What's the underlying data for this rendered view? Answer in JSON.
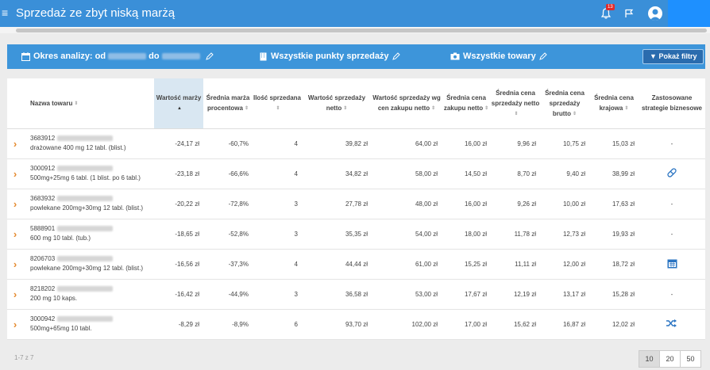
{
  "header": {
    "title": "Sprzedaż ze zbyt niską marżą",
    "notification_count": "13"
  },
  "filters": {
    "period_label": "Okres analizy: od",
    "period_to": "do",
    "points_label": "Wszystkie punkty sprzedaży",
    "products_label": "Wszystkie towary",
    "show_filters_label": "Pokaż filtry"
  },
  "table": {
    "columns": [
      "Nazwa towaru",
      "Wartość marży",
      "Średnia marża procentowa",
      "Ilość sprzedana",
      "Wartość sprzedaży netto",
      "Wartość sprzedaży wg cen zakupu netto",
      "Średnia cena zakupu netto",
      "Średnia cena sprzedaży netto",
      "Średnia cena sprzedaży brutto",
      "Średnia cena krajowa",
      "Zastosowane strategie biznesowe"
    ],
    "rows": [
      {
        "code": "3683912",
        "desc": "drażowane 400 mg 12 tabl. (blist.)",
        "margin_value": "-24,17 zł",
        "margin_pct": "-60,7%",
        "qty": "4",
        "sales_net": "39,82 zł",
        "sales_purchase": "64,00 zł",
        "avg_purchase": "16,00 zł",
        "avg_sale_net": "9,96 zł",
        "avg_sale_gross": "10,75 zł",
        "avg_national": "15,03 zł",
        "strategy": "-",
        "strategy_icon": ""
      },
      {
        "code": "3000912",
        "desc": "500mg+25mg 6 tabl. (1 blist. po 6 tabl.)",
        "margin_value": "-23,18 zł",
        "margin_pct": "-66,6%",
        "qty": "4",
        "sales_net": "34,82 zł",
        "sales_purchase": "58,00 zł",
        "avg_purchase": "14,50 zł",
        "avg_sale_net": "8,70 zł",
        "avg_sale_gross": "9,40 zł",
        "avg_national": "38,99 zł",
        "strategy": "",
        "strategy_icon": "pill-icon"
      },
      {
        "code": "3683932",
        "desc": "powlekane 200mg+30mg 12 tabl. (blist.)",
        "margin_value": "-20,22 zł",
        "margin_pct": "-72,8%",
        "qty": "3",
        "sales_net": "27,78 zł",
        "sales_purchase": "48,00 zł",
        "avg_purchase": "16,00 zł",
        "avg_sale_net": "9,26 zł",
        "avg_sale_gross": "10,00 zł",
        "avg_national": "17,63 zł",
        "strategy": "-",
        "strategy_icon": ""
      },
      {
        "code": "5888901",
        "desc": "600 mg 10 tabl. (tub.)",
        "margin_value": "-18,65 zł",
        "margin_pct": "-52,8%",
        "qty": "3",
        "sales_net": "35,35 zł",
        "sales_purchase": "54,00 zł",
        "avg_purchase": "18,00 zł",
        "avg_sale_net": "11,78 zł",
        "avg_sale_gross": "12,73 zł",
        "avg_national": "19,93 zł",
        "strategy": "-",
        "strategy_icon": ""
      },
      {
        "code": "8206703",
        "desc": "powlekane 200mg+30mg 12 tabl. (blist.)",
        "margin_value": "-16,56 zł",
        "margin_pct": "-37,3%",
        "qty": "4",
        "sales_net": "44,44 zł",
        "sales_purchase": "61,00 zł",
        "avg_purchase": "15,25 zł",
        "avg_sale_net": "11,11 zł",
        "avg_sale_gross": "12,00 zł",
        "avg_national": "18,72 zł",
        "strategy": "",
        "strategy_icon": "calendar-icon"
      },
      {
        "code": "8218202",
        "desc": "200 mg 10 kaps.",
        "margin_value": "-16,42 zł",
        "margin_pct": "-44,9%",
        "qty": "3",
        "sales_net": "36,58 zł",
        "sales_purchase": "53,00 zł",
        "avg_purchase": "17,67 zł",
        "avg_sale_net": "12,19 zł",
        "avg_sale_gross": "13,17 zł",
        "avg_national": "15,28 zł",
        "strategy": "-",
        "strategy_icon": ""
      },
      {
        "code": "3000942",
        "desc": "500mg+65mg 10 tabl.",
        "margin_value": "-8,29 zł",
        "margin_pct": "-8,9%",
        "qty": "6",
        "sales_net": "93,70 zł",
        "sales_purchase": "102,00 zł",
        "avg_purchase": "17,00 zł",
        "avg_sale_net": "15,62 zł",
        "avg_sale_gross": "16,87 zł",
        "avg_national": "12,02 zł",
        "strategy": "",
        "strategy_icon": "shuffle-icon"
      }
    ]
  },
  "footer": {
    "count_text": "1-7 z 7",
    "page_sizes": [
      "10",
      "20",
      "50"
    ],
    "active_page_size": "10"
  },
  "colors": {
    "brand_blue": "#3a8fd8",
    "accent_orange": "#e58a2e",
    "strategy_blue": "#2a74c2"
  }
}
